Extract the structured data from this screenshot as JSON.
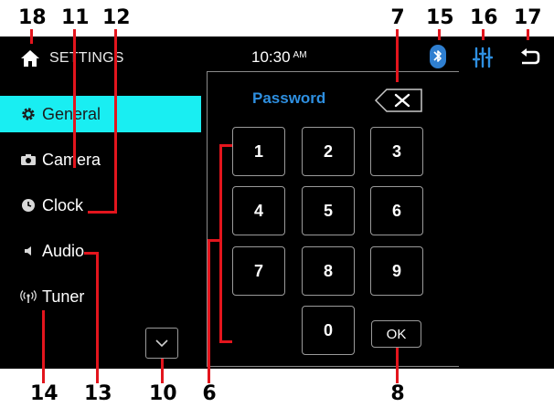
{
  "callouts": {
    "c18": "18",
    "c11": "11",
    "c12": "12",
    "c7": "7",
    "c15": "15",
    "c16": "16",
    "c17": "17",
    "c14": "14",
    "c13": "13",
    "c10": "10",
    "c6": "6",
    "c8": "8"
  },
  "topbar": {
    "title": "SETTINGS",
    "time": "10:30",
    "ampm": "AM",
    "icons": [
      "home-icon",
      "bluetooth-icon",
      "equalizer-icon",
      "back-icon"
    ]
  },
  "sidebar": {
    "items": [
      {
        "label": "General",
        "icon": "gear-icon",
        "active": true
      },
      {
        "label": "Camera",
        "icon": "camera-icon",
        "active": false
      },
      {
        "label": "Clock",
        "icon": "clock-icon",
        "active": false
      },
      {
        "label": "Audio",
        "icon": "speaker-icon",
        "active": false
      },
      {
        "label": "Tuner",
        "icon": "antenna-icon",
        "active": false
      }
    ]
  },
  "password_dialog": {
    "title": "Password",
    "keys": [
      "1",
      "2",
      "3",
      "4",
      "5",
      "6",
      "7",
      "8",
      "9",
      "0"
    ],
    "ok_label": "OK"
  },
  "colors": {
    "accent": "#19eef2",
    "password_title": "#2e8fe0",
    "bluetooth": "#2f7fd0",
    "callout_line": "#e3151d"
  }
}
